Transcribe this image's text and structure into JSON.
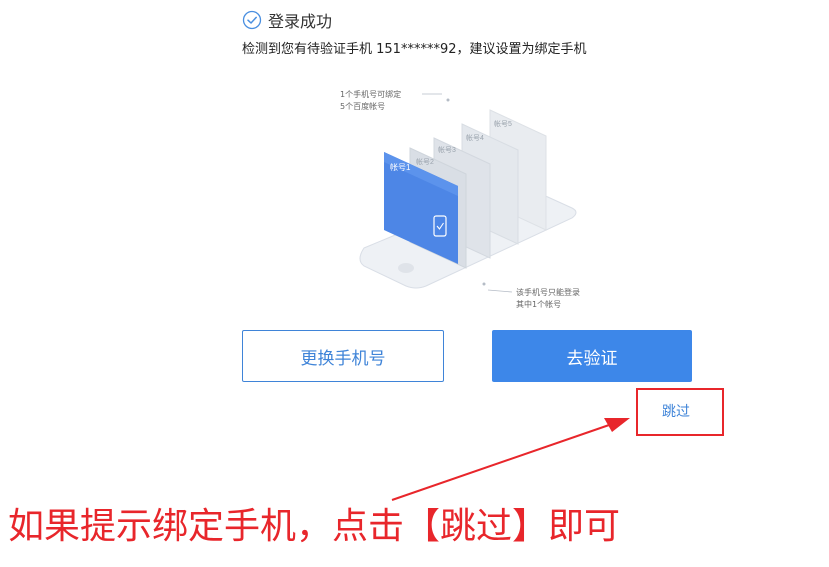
{
  "status": {
    "title": "登录成功",
    "message": "检测到您有待验证手机 151******92，建议设置为绑定手机"
  },
  "illustration": {
    "note_top_line1": "1个手机号可绑定",
    "note_top_line2": "5个百度帐号",
    "note_bottom_line1": "该手机号只能登录",
    "note_bottom_line2": "其中1个帐号",
    "card_labels": [
      "帐号1",
      "帐号2",
      "帐号3",
      "帐号4",
      "帐号5"
    ]
  },
  "actions": {
    "change_phone_label": "更换手机号",
    "verify_label": "去验证",
    "skip_label": "跳过"
  },
  "annotation": {
    "instruction": "如果提示绑定手机，点击【跳过】即可"
  },
  "colors": {
    "primary": "#3d87e9",
    "accent_red": "#e8262b",
    "link": "#3f84d8"
  }
}
